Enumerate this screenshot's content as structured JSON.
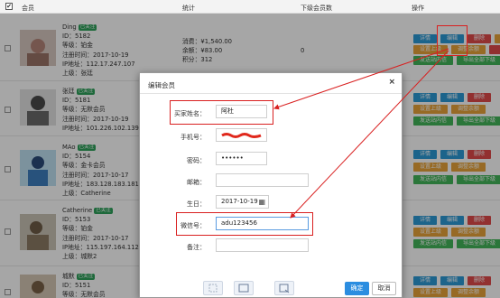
{
  "header": {
    "col_member": "会员",
    "col_stats": "统计",
    "col_sub": "下级会员数",
    "col_ops": "操作"
  },
  "rows": [
    {
      "name": "Ding",
      "badge": "已关注",
      "id": "ID：5182",
      "level": "等级：铂金",
      "reg": "注册时间：2017-10-19",
      "ip": "IP地址：112.17.247.107",
      "parent": "上级：张廷",
      "consume": "消费：¥1,540.00",
      "balance": "余额：¥83.00",
      "points": "积分：312",
      "sub_count": "0"
    },
    {
      "name": "张廷",
      "badge": "已关注",
      "id": "ID：5181",
      "level": "等级：无默会员",
      "reg": "注册时间：2017-10-19",
      "ip": "IP地址：101.226.102.139",
      "parent": "",
      "consume": "",
      "balance": "",
      "points": "",
      "sub_count": ""
    },
    {
      "name": "MAo",
      "badge": "已关注",
      "id": "ID：5154",
      "level": "等级：金卡会员",
      "reg": "注册时间：2017-10-17",
      "ip": "IP地址：183.128.183.181",
      "parent": "上级：Catherine",
      "consume": "",
      "balance": "",
      "points": "",
      "sub_count": ""
    },
    {
      "name": "Catherine",
      "badge": "已关注",
      "id": "ID：5153",
      "level": "等级：铂金",
      "reg": "注册时间：2017-10-17",
      "ip": "IP地址：115.197.164.112",
      "parent": "上级：城默2",
      "consume": "",
      "balance": "",
      "points": "",
      "sub_count": ""
    },
    {
      "name": "城默",
      "badge": "已关注",
      "id": "ID：5151",
      "level": "等级：无默会员",
      "reg": "",
      "ip": "",
      "parent": "",
      "consume": "",
      "balance": "",
      "points": "",
      "sub_count": ""
    }
  ],
  "ops": {
    "detail": "详情",
    "edit": "编辑",
    "delete": "删除",
    "set_parent": "设置上级",
    "adjust_balance": "调整余额",
    "send_msg": "发送站内信",
    "export_sub": "导出全部下级"
  },
  "modal": {
    "title": "编辑会员",
    "close": "×",
    "buyer_label": "买家姓名：",
    "buyer_value": "阿杜",
    "phone_label": "手机号：",
    "password_label": "密码：",
    "password_value": "••••••",
    "email_label": "邮箱：",
    "email_value": "",
    "birthday_label": "生日：",
    "birthday_value": "2017-10-19",
    "wechat_label": "微信号：",
    "wechat_value": "adu123456",
    "remark_label": "备注：",
    "remark_value": "",
    "ok": "确定",
    "cancel": "取消"
  },
  "colors": {
    "accent_blue": "#2b9ad6",
    "danger_red": "#e04a4a",
    "warn_orange": "#e8a43a",
    "success_green": "#42b55a",
    "annotation_red": "#d92020"
  }
}
